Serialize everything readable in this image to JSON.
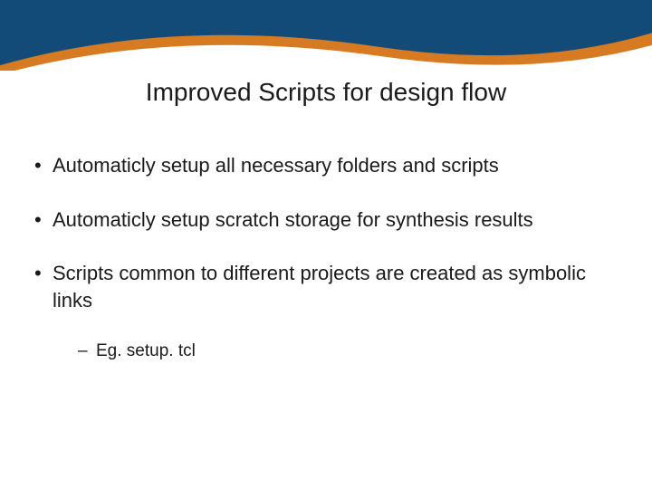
{
  "title": "Improved Scripts for design flow",
  "bullets": {
    "b0": {
      "text": "Automaticly setup all necessary folders and scripts"
    },
    "b1": {
      "text": "Automaticly setup scratch storage for synthesis results"
    },
    "b2": {
      "text": "Scripts common to different projects are created as symbolic links",
      "sub0": "Eg. setup. tcl"
    }
  },
  "colors": {
    "banner_bg": "#134b78",
    "swoosh": "#d77b23"
  }
}
